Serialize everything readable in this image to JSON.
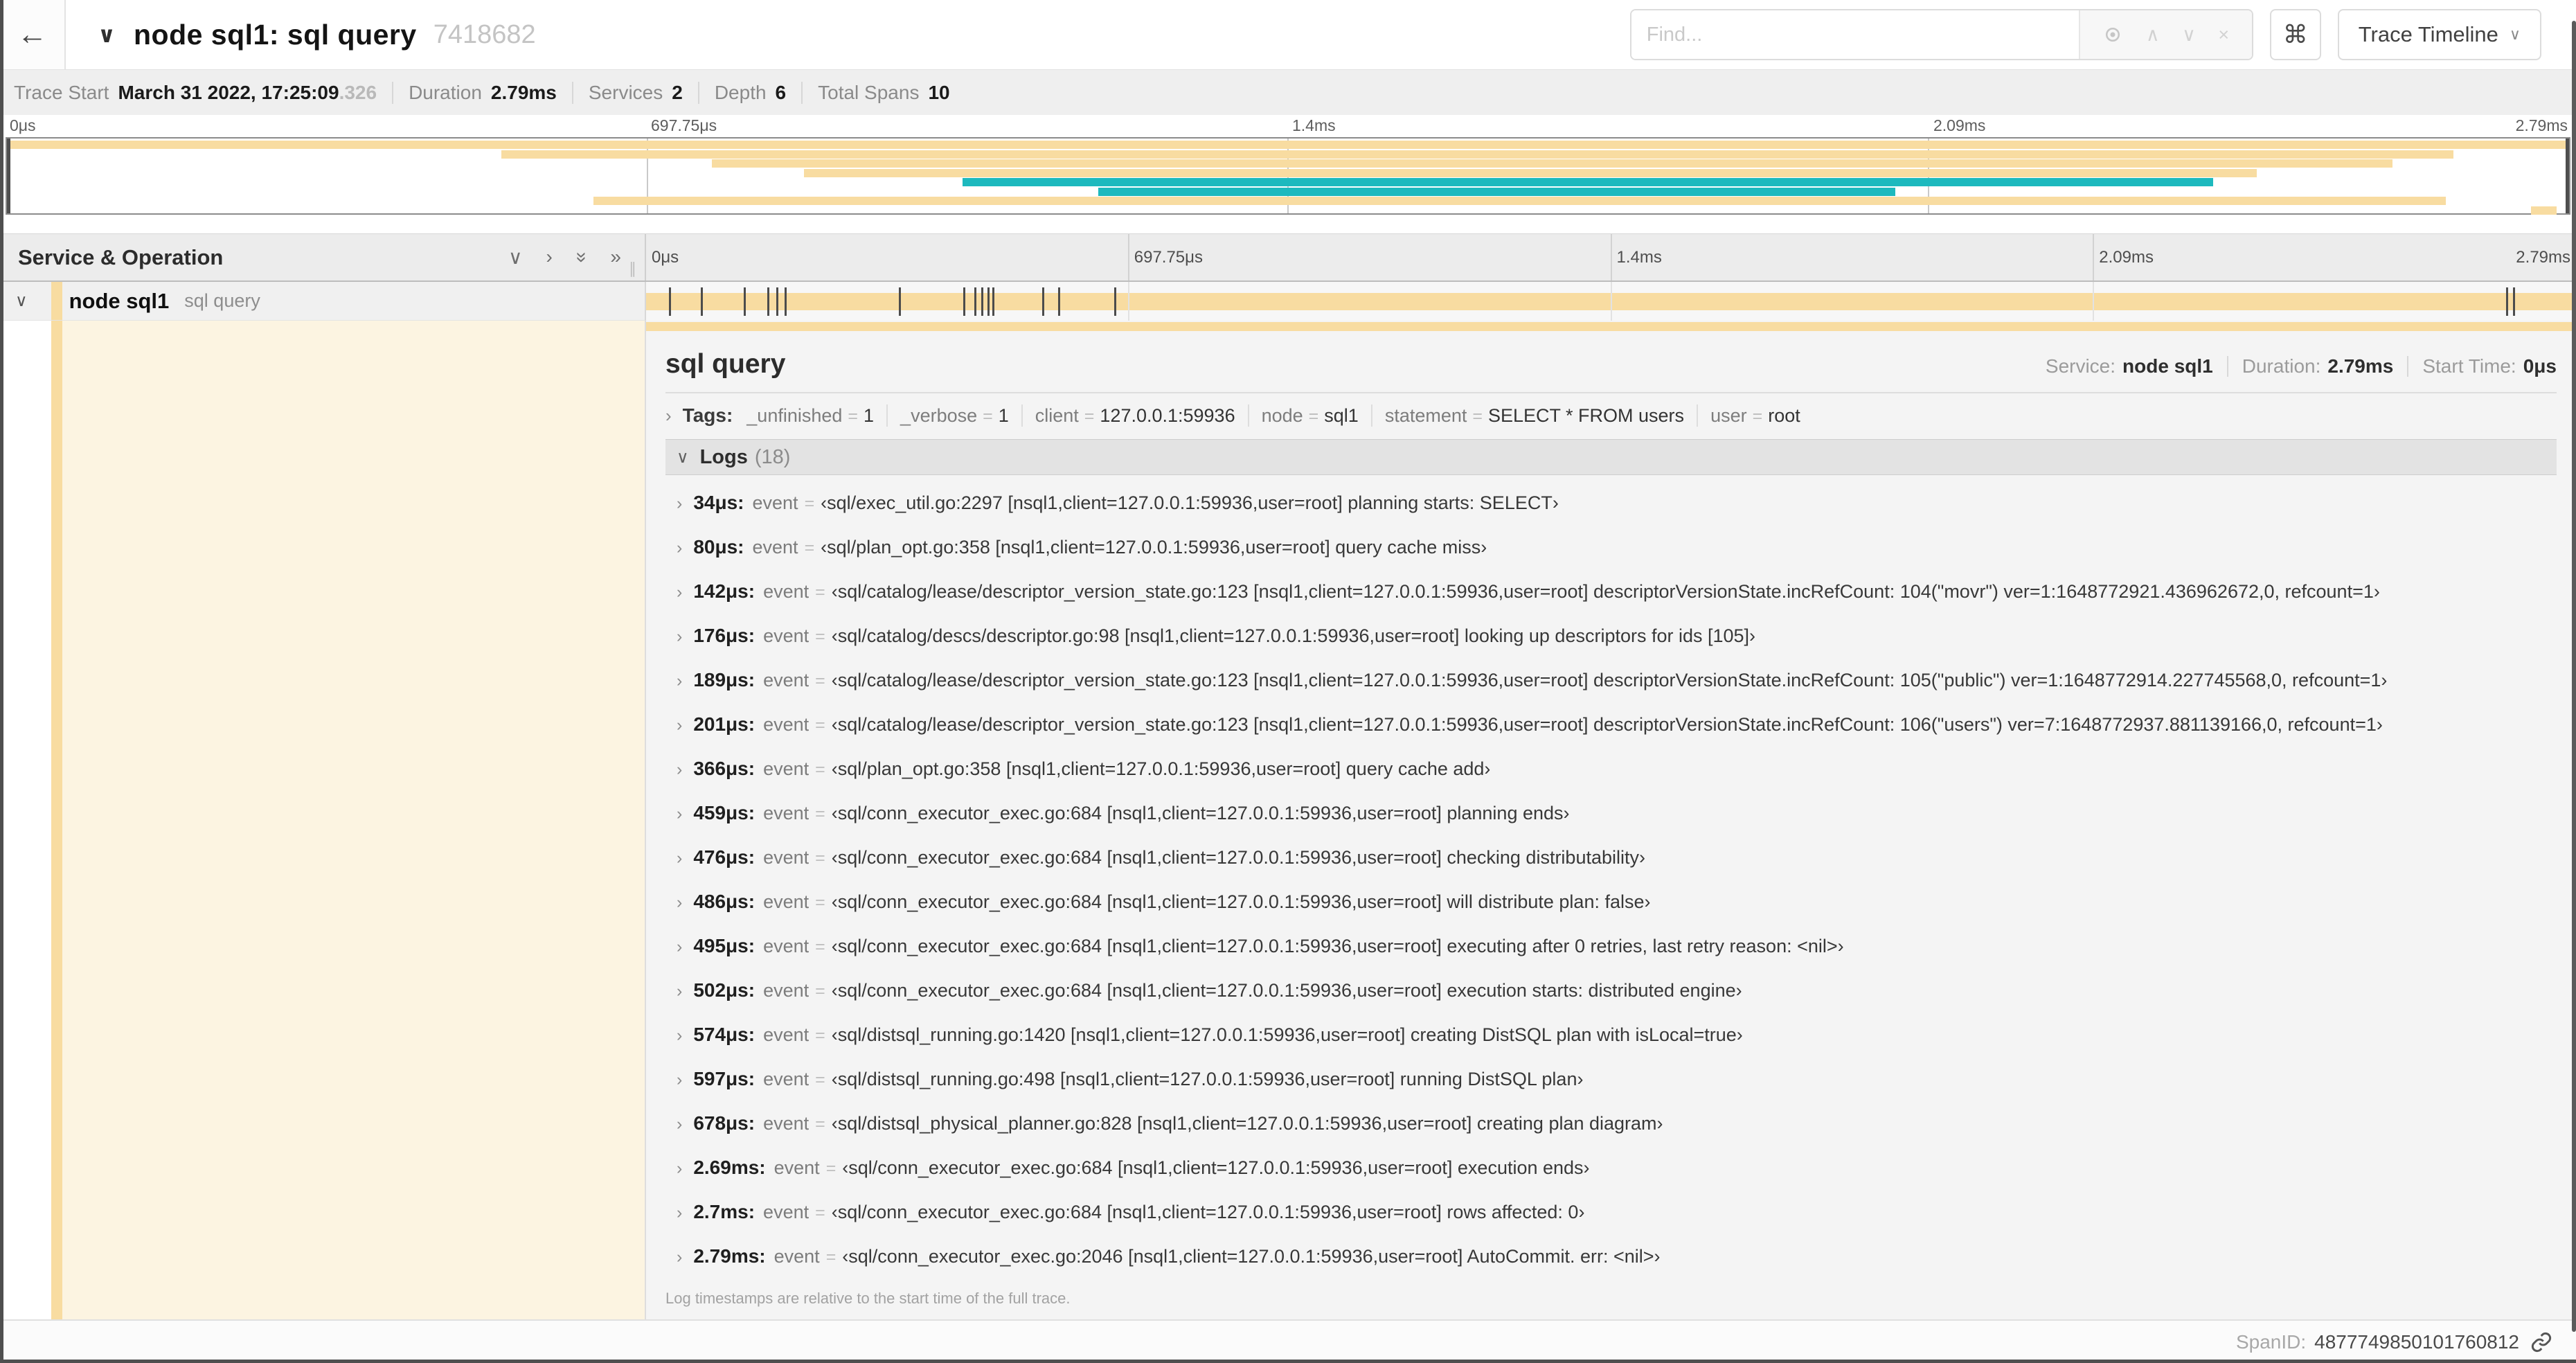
{
  "header": {
    "back_icon": "←",
    "collapse_icon": "∨",
    "title": "node sql1: sql query",
    "trace_id": "7418682",
    "find_placeholder": "Find...",
    "shortcut_key": "⌘",
    "view_select": "Trace Timeline",
    "view_select_chevron": "∨"
  },
  "trace_bar": {
    "items": [
      {
        "label": "Trace Start",
        "value": "March 31 2022, 17:25:09",
        "muted": ".326"
      },
      {
        "label": "Duration",
        "value": "2.79ms"
      },
      {
        "label": "Services",
        "value": "2"
      },
      {
        "label": "Depth",
        "value": "6"
      },
      {
        "label": "Total Spans",
        "value": "10"
      }
    ]
  },
  "colors": {
    "tan": "#F8DCA1",
    "teal": "#1DB9BE",
    "cream": "#FCF4E1"
  },
  "timeline": {
    "duration_us": 2790,
    "ticks": [
      {
        "label": "0μs",
        "frac": 0
      },
      {
        "label": "697.75μs",
        "frac": 0.25
      },
      {
        "label": "1.4ms",
        "frac": 0.5
      },
      {
        "label": "2.09ms",
        "frac": 0.75
      },
      {
        "label": "2.79ms",
        "frac": 1
      }
    ]
  },
  "minimap": {
    "spans": [
      {
        "start": 0.0,
        "end": 1.0,
        "color": "tan"
      },
      {
        "start": 0.193,
        "end": 0.955,
        "color": "tan"
      },
      {
        "start": 0.275,
        "end": 0.931,
        "color": "tan"
      },
      {
        "start": 0.311,
        "end": 0.878,
        "color": "tan"
      },
      {
        "start": 0.373,
        "end": 0.861,
        "color": "teal"
      },
      {
        "start": 0.426,
        "end": 0.737,
        "color": "teal"
      },
      {
        "start": 0.229,
        "end": 0.952,
        "color": "tan"
      },
      {
        "start": 0.985,
        "end": 0.995,
        "color": "tan"
      }
    ]
  },
  "span_list": {
    "header": "Service & Operation",
    "icons": {
      "collapse_one": "∨",
      "expand_one": "›",
      "collapse_all": "»",
      "expand_all": "»"
    },
    "row": {
      "chevron": "∨",
      "service": "node sql1",
      "operation": "sql query"
    }
  },
  "detail": {
    "title": "sql query",
    "meta": [
      {
        "label": "Service:",
        "value": "node sql1"
      },
      {
        "label": "Duration:",
        "value": "2.79ms"
      },
      {
        "label": "Start Time:",
        "value": "0μs"
      }
    ],
    "tags_label": "Tags:",
    "tags": [
      {
        "key": "_unfinished",
        "value": "1"
      },
      {
        "key": "_verbose",
        "value": "1"
      },
      {
        "key": "client",
        "value": "127.0.0.1:59936"
      },
      {
        "key": "node",
        "value": "sql1"
      },
      {
        "key": "statement",
        "value": "SELECT * FROM users"
      },
      {
        "key": "user",
        "value": "root"
      }
    ],
    "logs_label": "Logs",
    "logs_count": "(18)",
    "log_field": "event",
    "logs": [
      {
        "time": "34μs",
        "time_us": 34,
        "message": "‹sql/exec_util.go:2297 [nsql1,client=127.0.0.1:59936,user=root] planning starts: SELECT›"
      },
      {
        "time": "80μs",
        "time_us": 80,
        "message": "‹sql/plan_opt.go:358 [nsql1,client=127.0.0.1:59936,user=root] query cache miss›"
      },
      {
        "time": "142μs",
        "time_us": 142,
        "message": "‹sql/catalog/lease/descriptor_version_state.go:123 [nsql1,client=127.0.0.1:59936,user=root] descriptorVersionState.incRefCount: 104(\"movr\") ver=1:1648772921.436962672,0, refcount=1›"
      },
      {
        "time": "176μs",
        "time_us": 176,
        "message": "‹sql/catalog/descs/descriptor.go:98 [nsql1,client=127.0.0.1:59936,user=root] looking up descriptors for ids [105]›"
      },
      {
        "time": "189μs",
        "time_us": 189,
        "message": "‹sql/catalog/lease/descriptor_version_state.go:123 [nsql1,client=127.0.0.1:59936,user=root] descriptorVersionState.incRefCount: 105(\"public\") ver=1:1648772914.227745568,0, refcount=1›"
      },
      {
        "time": "201μs",
        "time_us": 201,
        "message": "‹sql/catalog/lease/descriptor_version_state.go:123 [nsql1,client=127.0.0.1:59936,user=root] descriptorVersionState.incRefCount: 106(\"users\") ver=7:1648772937.881139166,0, refcount=1›"
      },
      {
        "time": "366μs",
        "time_us": 366,
        "message": "‹sql/plan_opt.go:358 [nsql1,client=127.0.0.1:59936,user=root] query cache add›"
      },
      {
        "time": "459μs",
        "time_us": 459,
        "message": "‹sql/conn_executor_exec.go:684 [nsql1,client=127.0.0.1:59936,user=root] planning ends›"
      },
      {
        "time": "476μs",
        "time_us": 476,
        "message": "‹sql/conn_executor_exec.go:684 [nsql1,client=127.0.0.1:59936,user=root] checking distributability›"
      },
      {
        "time": "486μs",
        "time_us": 486,
        "message": "‹sql/conn_executor_exec.go:684 [nsql1,client=127.0.0.1:59936,user=root] will distribute plan: false›"
      },
      {
        "time": "495μs",
        "time_us": 495,
        "message": "‹sql/conn_executor_exec.go:684 [nsql1,client=127.0.0.1:59936,user=root] executing after 0 retries, last retry reason: <nil>›"
      },
      {
        "time": "502μs",
        "time_us": 502,
        "message": "‹sql/conn_executor_exec.go:684 [nsql1,client=127.0.0.1:59936,user=root] execution starts: distributed engine›"
      },
      {
        "time": "574μs",
        "time_us": 574,
        "message": "‹sql/distsql_running.go:1420 [nsql1,client=127.0.0.1:59936,user=root] creating DistSQL plan with isLocal=true›"
      },
      {
        "time": "597μs",
        "time_us": 597,
        "message": "‹sql/distsql_running.go:498 [nsql1,client=127.0.0.1:59936,user=root] running DistSQL plan›"
      },
      {
        "time": "678μs",
        "time_us": 678,
        "message": "‹sql/distsql_physical_planner.go:828 [nsql1,client=127.0.0.1:59936,user=root] creating plan diagram›"
      },
      {
        "time": "2.69ms",
        "time_us": 2690,
        "message": "‹sql/conn_executor_exec.go:684 [nsql1,client=127.0.0.1:59936,user=root] execution ends›"
      },
      {
        "time": "2.7ms",
        "time_us": 2700,
        "message": "‹sql/conn_executor_exec.go:684 [nsql1,client=127.0.0.1:59936,user=root] rows affected: 0›"
      },
      {
        "time": "2.79ms",
        "time_us": 2790,
        "message": "‹sql/conn_executor_exec.go:2046 [nsql1,client=127.0.0.1:59936,user=root] AutoCommit. err: <nil>›"
      }
    ],
    "note": "Log timestamps are relative to the start time of the full trace.",
    "footer_label": "SpanID:",
    "span_id": "4877749850101760812"
  }
}
